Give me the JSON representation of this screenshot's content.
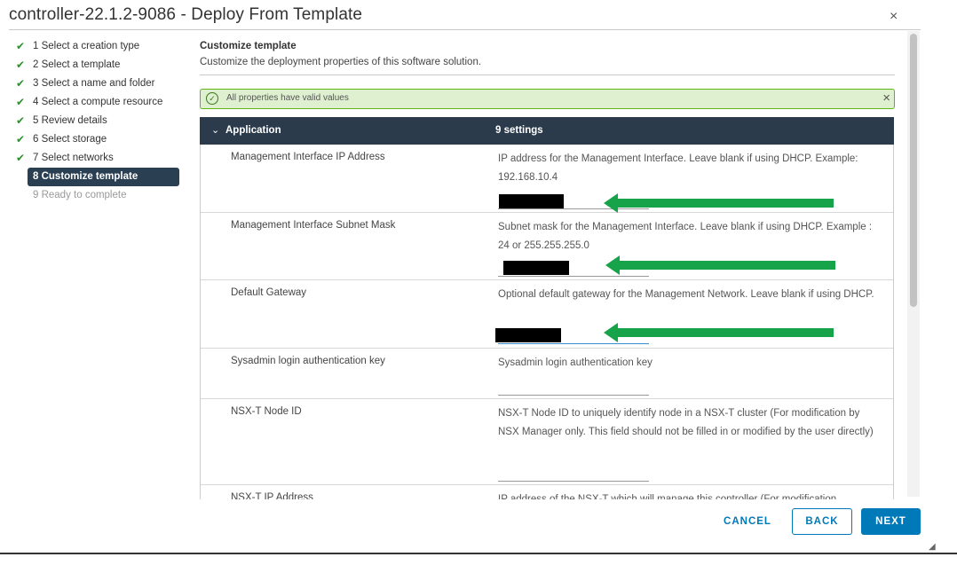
{
  "window": {
    "title": "controller-22.1.2-9086 - Deploy From Template",
    "close_glyph": "×"
  },
  "steps": [
    {
      "label": "1 Select a creation type",
      "state": "done"
    },
    {
      "label": "2 Select a template",
      "state": "done"
    },
    {
      "label": "3 Select a name and folder",
      "state": "done"
    },
    {
      "label": "4 Select a compute resource",
      "state": "done"
    },
    {
      "label": "5 Review details",
      "state": "done"
    },
    {
      "label": "6 Select storage",
      "state": "done"
    },
    {
      "label": "7 Select networks",
      "state": "done"
    },
    {
      "label": "8 Customize template",
      "state": "active"
    },
    {
      "label": "9 Ready to complete",
      "state": "disabled"
    }
  ],
  "main": {
    "title": "Customize template",
    "subtitle": "Customize the deployment properties of this software solution."
  },
  "alert": {
    "text": "All properties have valid values",
    "icon": "check-circle-icon",
    "color": "#60b515"
  },
  "table": {
    "group": "Application",
    "count": "9 settings",
    "rows": [
      {
        "label": "Management Interface IP Address",
        "desc": "IP address for the Management Interface. Leave blank if using DHCP. Example: 192.168.10.4",
        "value": "",
        "redacted": true
      },
      {
        "label": "Management Interface Subnet Mask",
        "desc": "Subnet mask for the Management Interface. Leave blank if using DHCP. Example : 24 or 255.255.255.0",
        "value": "",
        "redacted": true
      },
      {
        "label": "Default Gateway",
        "desc": "Optional default gateway for the Management Network. Leave blank if using DHCP.",
        "value": "",
        "redacted": true
      },
      {
        "label": "Sysadmin login authentication key",
        "desc": "Sysadmin login authentication key",
        "value": ""
      },
      {
        "label": "NSX-T Node ID",
        "desc": "NSX-T Node ID to uniquely identify node in a NSX-T cluster (For modification by NSX Manager only. This field should not be filled in or modified by the user directly)",
        "value": ""
      },
      {
        "label": "NSX-T IP Address",
        "desc": "IP address of the NSX-T which will manage this controller (For modification",
        "value": ""
      }
    ]
  },
  "buttons": {
    "cancel": "CANCEL",
    "back": "BACK",
    "next": "NEXT"
  },
  "colors": {
    "accent": "#0079b8",
    "header_bg": "#2b3b4c",
    "annotation_arrow": "#16a34a",
    "check": "#2f8f2f"
  }
}
